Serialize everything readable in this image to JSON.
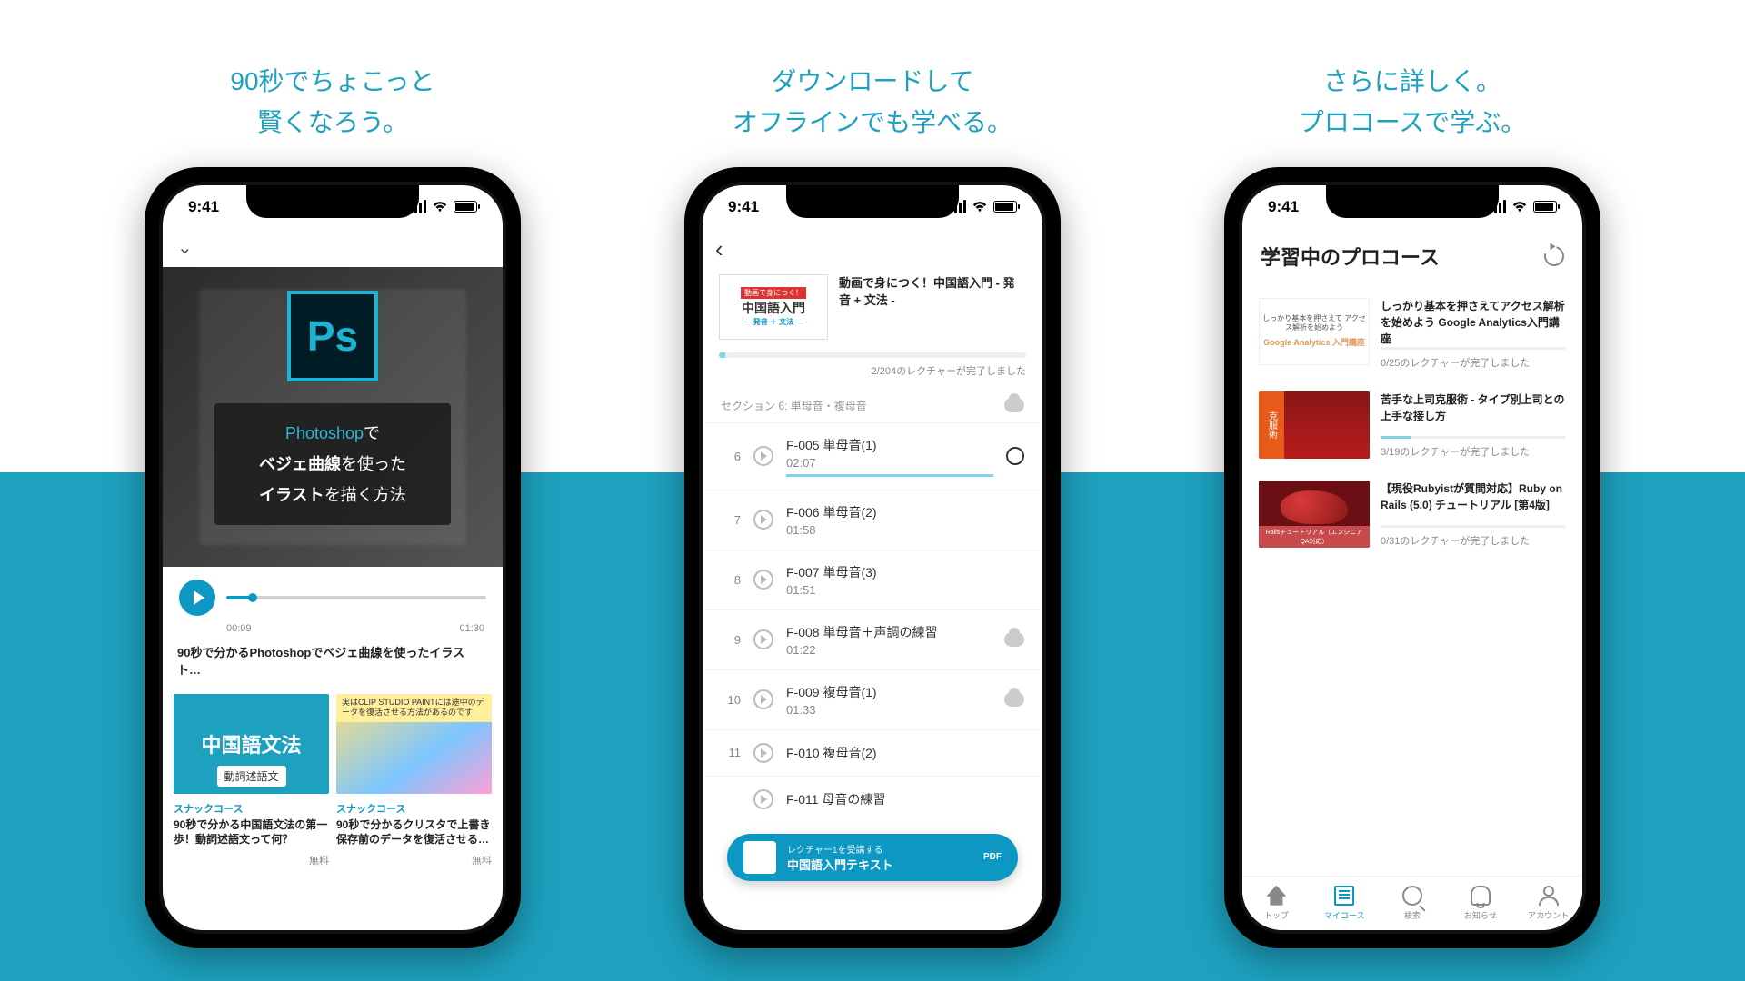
{
  "status_time": "9:41",
  "columns": [
    {
      "tagline1": "90秒でちょこっと",
      "tagline2": "賢くなろう。"
    },
    {
      "tagline1": "ダウンロードして",
      "tagline2": "オフラインでも学べる。"
    },
    {
      "tagline1": "さらに詳しく。",
      "tagline2": "プロコースで学ぶ。"
    }
  ],
  "screen1": {
    "ps_label": "Ps",
    "overlay_line1_a": "Photoshop",
    "overlay_line1_b": "で",
    "overlay_line2_a": "ベジェ曲線",
    "overlay_line2_b": "を使った",
    "overlay_line3_a": "イラスト",
    "overlay_line3_b": "を描く方法",
    "time_current": "00:09",
    "time_total": "01:30",
    "video_title": "90秒で分かるPhotoshopでベジェ曲線を使ったイラスト…",
    "cards": [
      {
        "thumb_main": "中国語文法",
        "thumb_sub": "動詞述語文",
        "category": "スナックコース",
        "title": "90秒で分かる中国語文法の第一歩！動詞述語文って何？",
        "price": "無料"
      },
      {
        "thumb_banner": "実はCLIP STUDIO PAINTには途中のデータを復活させる方法があるのです",
        "category": "スナックコース",
        "title": "90秒で分かるクリスタで上書き保存前のデータを復活させる…",
        "price": "無料"
      }
    ]
  },
  "screen2": {
    "thumb_red": "動画で身につく！",
    "thumb_main": "中国語入門",
    "thumb_sub": "― 発音 ＋ 文法 ―",
    "course_title": "動画で身につく！中国語入門 - 発音 + 文法 -",
    "progress_label": "2/204のレクチャーが完了しました",
    "section_label": "セクション 6: 単母音・複母音",
    "lectures": [
      {
        "n": "6",
        "title": "F-005 単母音(1)",
        "dur": "02:07",
        "bar": true,
        "ring": true
      },
      {
        "n": "7",
        "title": "F-006 単母音(2)",
        "dur": "01:58"
      },
      {
        "n": "8",
        "title": "F-007 単母音(3)",
        "dur": "01:51"
      },
      {
        "n": "9",
        "title": "F-008 単母音＋声調の練習",
        "dur": "01:22",
        "cloud": true
      },
      {
        "n": "10",
        "title": "F-009 複母音(1)",
        "dur": "01:33",
        "cloud": true
      },
      {
        "n": "11",
        "title": "F-010 複母音(2)",
        "dur": ""
      },
      {
        "n": "",
        "title": "F-011 母音の練習",
        "dur": ""
      }
    ],
    "pdf_line1": "レクチャー1を受講する",
    "pdf_line2": "中国語入門テキスト",
    "pdf_badge": "PDF"
  },
  "screen3": {
    "header": "学習中のプロコース",
    "items": [
      {
        "title": "しっかり基本を押さえてアクセス解析を始めよう Google Analytics入門講座",
        "label": "0/25のレクチャーが完了しました",
        "prg": 0,
        "th": "ga",
        "th_top": "しっかり基本を押さえて\nアクセス解析を始めよう",
        "th_bot": "Google Analytics 入門講座"
      },
      {
        "title": "苦手な上司克服術 - タイプ別上司との上手な接し方",
        "label": "3/19のレクチャーが完了しました",
        "prg": 16,
        "th": "red",
        "th_side": "克服術"
      },
      {
        "title": "【現役Rubyistが質問対応】Ruby on Rails (5.0) チュートリアル [第4版]",
        "label": "0/31のレクチャーが完了しました",
        "prg": 0,
        "th": "rails",
        "th_cap": "Railsチュートリアル（エンジニアQA対応）"
      }
    ],
    "tabs": [
      {
        "label": "トップ"
      },
      {
        "label": "マイコース"
      },
      {
        "label": "検索"
      },
      {
        "label": "お知らせ"
      },
      {
        "label": "アカウント"
      }
    ]
  }
}
